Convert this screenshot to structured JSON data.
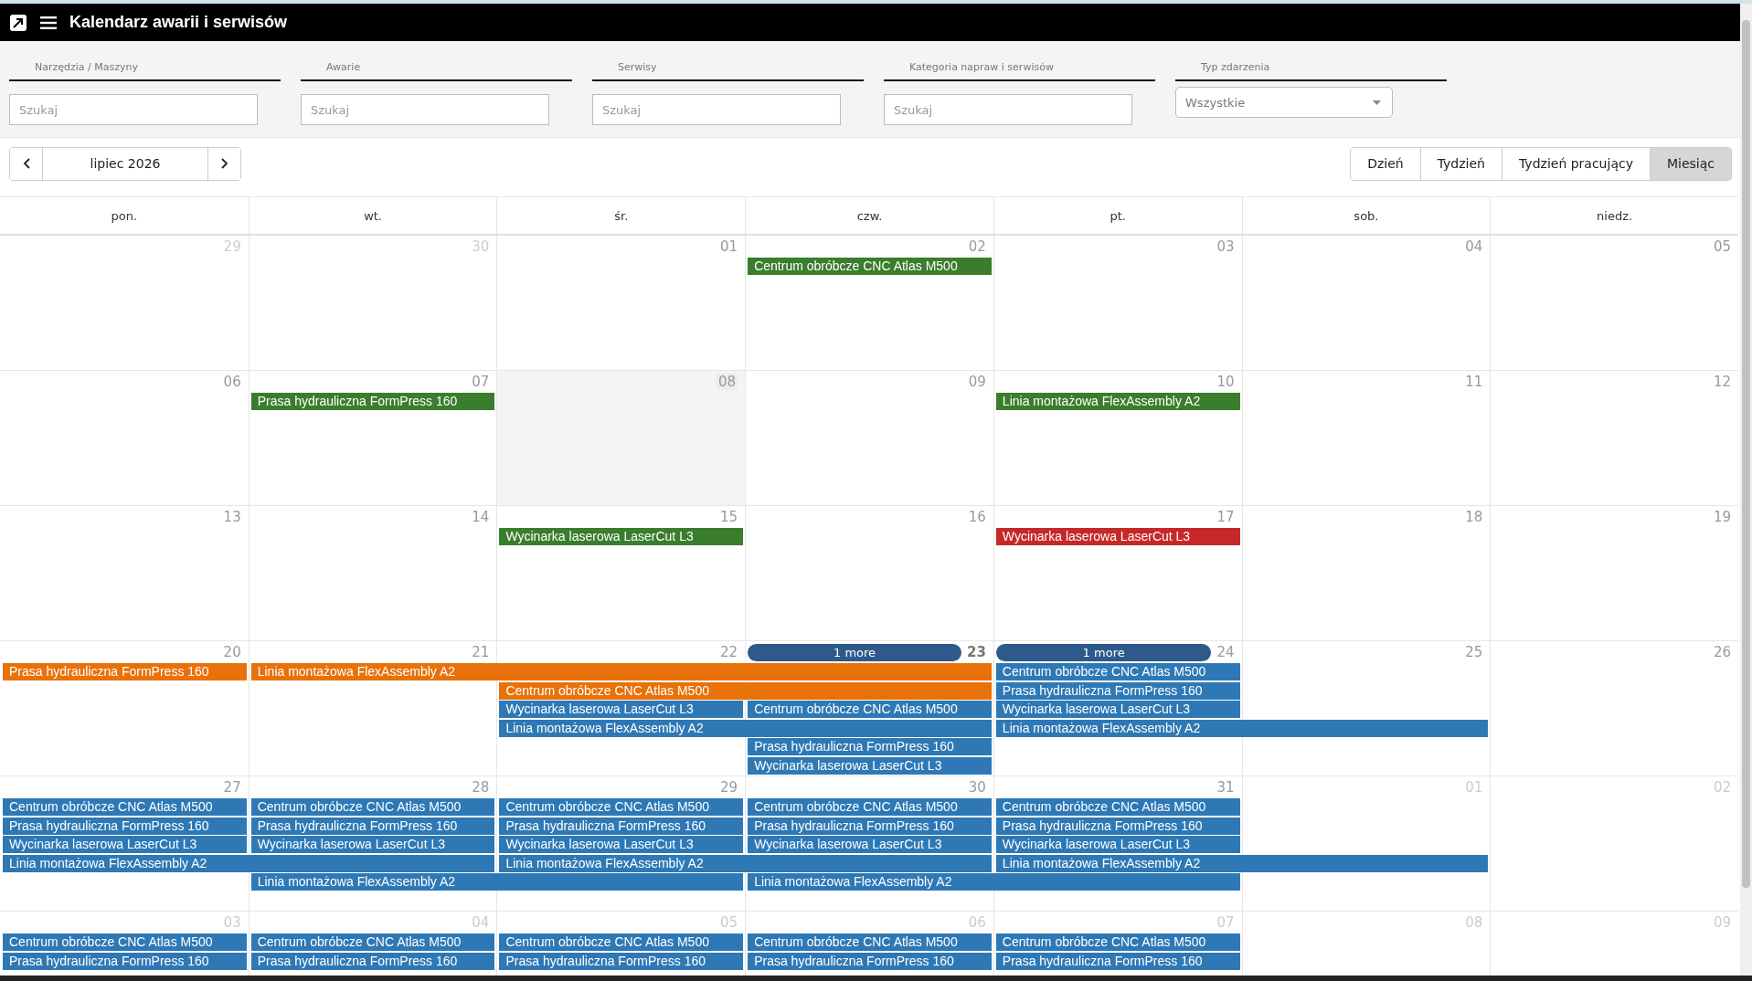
{
  "window": {
    "title": "Kalendarz awarii i serwisów"
  },
  "filters": [
    {
      "kind": "search",
      "label": "Narzędzia / Maszyny",
      "placeholder": "Szukaj"
    },
    {
      "kind": "search",
      "label": "Awarie",
      "placeholder": "Szukaj"
    },
    {
      "kind": "search",
      "label": "Serwisy",
      "placeholder": "Szukaj"
    },
    {
      "kind": "search",
      "label": "Kategoria napraw i serwisów",
      "placeholder": "Szukaj"
    },
    {
      "kind": "select",
      "label": "Typ zdarzenia",
      "value": "Wszystkie"
    }
  ],
  "navigation": {
    "period": "lipiec 2026"
  },
  "views": [
    {
      "label": "Dzień",
      "selected": false
    },
    {
      "label": "Tydzień",
      "selected": false
    },
    {
      "label": "Tydzień pracujący",
      "selected": false
    },
    {
      "label": "Miesiąc",
      "selected": true
    }
  ],
  "weekdays": [
    "pon.",
    "wt.",
    "śr.",
    "czw.",
    "pt.",
    "sob.",
    "niedz."
  ],
  "weeks": [
    {
      "days": [
        {
          "date": "29",
          "other_month": true,
          "selected": false,
          "today": false
        },
        {
          "date": "30",
          "other_month": true,
          "selected": false,
          "today": false
        },
        {
          "date": "01",
          "other_month": false,
          "selected": false,
          "today": false
        },
        {
          "date": "02",
          "other_month": false,
          "selected": false,
          "today": false
        },
        {
          "date": "03",
          "other_month": false,
          "selected": false,
          "today": false
        },
        {
          "date": "04",
          "other_month": false,
          "selected": false,
          "today": false
        },
        {
          "date": "05",
          "other_month": false,
          "selected": false,
          "today": false
        }
      ],
      "lanes": [
        [
          {
            "kind": "empty"
          },
          {
            "kind": "empty"
          },
          {
            "kind": "empty"
          },
          {
            "kind": "event",
            "title": "Centrum obróbcze CNC Atlas M500",
            "color": "#3a7d2c"
          },
          {
            "kind": "empty"
          },
          {
            "kind": "empty"
          },
          {
            "kind": "empty"
          }
        ]
      ]
    },
    {
      "days": [
        {
          "date": "06",
          "other_month": false,
          "selected": false,
          "today": false
        },
        {
          "date": "07",
          "other_month": false,
          "selected": false,
          "today": false
        },
        {
          "date": "08",
          "other_month": false,
          "selected": true,
          "today": false
        },
        {
          "date": "09",
          "other_month": false,
          "selected": false,
          "today": false
        },
        {
          "date": "10",
          "other_month": false,
          "selected": false,
          "today": false
        },
        {
          "date": "11",
          "other_month": false,
          "selected": false,
          "today": false
        },
        {
          "date": "12",
          "other_month": false,
          "selected": false,
          "today": false
        }
      ],
      "lanes": [
        [
          {
            "kind": "empty"
          },
          {
            "kind": "event",
            "title": "Prasa hydrauliczna FormPress 160",
            "color": "#3a7d2c"
          },
          {
            "kind": "empty"
          },
          {
            "kind": "empty"
          },
          {
            "kind": "event",
            "title": "Linia montażowa FlexAssembly A2",
            "color": "#3a7d2c"
          },
          {
            "kind": "empty"
          },
          {
            "kind": "empty"
          }
        ]
      ]
    },
    {
      "days": [
        {
          "date": "13",
          "other_month": false,
          "selected": false,
          "today": false
        },
        {
          "date": "14",
          "other_month": false,
          "selected": false,
          "today": false
        },
        {
          "date": "15",
          "other_month": false,
          "selected": false,
          "today": false
        },
        {
          "date": "16",
          "other_month": false,
          "selected": false,
          "today": false
        },
        {
          "date": "17",
          "other_month": false,
          "selected": false,
          "today": false
        },
        {
          "date": "18",
          "other_month": false,
          "selected": false,
          "today": false
        },
        {
          "date": "19",
          "other_month": false,
          "selected": false,
          "today": false
        }
      ],
      "lanes": [
        [
          {
            "kind": "empty"
          },
          {
            "kind": "empty"
          },
          {
            "kind": "event",
            "title": "Wycinarka laserowa LaserCut L3",
            "color": "#3a7d2c"
          },
          {
            "kind": "empty"
          },
          {
            "kind": "event",
            "title": "Wycinarka laserowa LaserCut L3",
            "color": "#c62828"
          },
          {
            "kind": "empty"
          },
          {
            "kind": "empty"
          }
        ]
      ]
    },
    {
      "days": [
        {
          "date": "20",
          "other_month": false,
          "selected": false,
          "today": false
        },
        {
          "date": "21",
          "other_month": false,
          "selected": false,
          "today": false
        },
        {
          "date": "22",
          "other_month": false,
          "selected": false,
          "today": false
        },
        {
          "date": "23",
          "other_month": false,
          "selected": false,
          "today": true,
          "more": "1 more"
        },
        {
          "date": "24",
          "other_month": false,
          "selected": false,
          "today": false,
          "more": "1 more"
        },
        {
          "date": "25",
          "other_month": false,
          "selected": false,
          "today": false
        },
        {
          "date": "26",
          "other_month": false,
          "selected": false,
          "today": false
        }
      ],
      "lanes": [
        [
          {
            "kind": "event",
            "title": "Prasa hydrauliczna FormPress 160",
            "color": "#e8710a"
          },
          {
            "kind": "event",
            "title": "Linia montażowa FlexAssembly A2",
            "color": "#e8710a"
          },
          {
            "kind": "continued"
          },
          {
            "kind": "continued"
          },
          {
            "kind": "event",
            "title": "Centrum obróbcze CNC Atlas M500",
            "color": "#2e79b5"
          },
          {
            "kind": "empty"
          },
          {
            "kind": "empty"
          }
        ],
        [
          {
            "kind": "empty"
          },
          {
            "kind": "empty"
          },
          {
            "kind": "event",
            "title": "Centrum obróbcze CNC Atlas M500",
            "color": "#e8710a"
          },
          {
            "kind": "continued"
          },
          {
            "kind": "event",
            "title": "Prasa hydrauliczna FormPress 160",
            "color": "#2e79b5"
          },
          {
            "kind": "empty"
          },
          {
            "kind": "empty"
          }
        ],
        [
          {
            "kind": "empty"
          },
          {
            "kind": "empty"
          },
          {
            "kind": "event",
            "title": "Wycinarka laserowa LaserCut L3",
            "color": "#2e79b5"
          },
          {
            "kind": "event",
            "title": "Centrum obróbcze CNC Atlas M500",
            "color": "#2e79b5"
          },
          {
            "kind": "event",
            "title": "Wycinarka laserowa LaserCut L3",
            "color": "#2e79b5"
          },
          {
            "kind": "empty"
          },
          {
            "kind": "empty"
          }
        ],
        [
          {
            "kind": "empty"
          },
          {
            "kind": "empty"
          },
          {
            "kind": "event",
            "title": "Linia montażowa FlexAssembly A2",
            "color": "#2e79b5"
          },
          {
            "kind": "continued"
          },
          {
            "kind": "event",
            "title": "Linia montażowa FlexAssembly A2",
            "color": "#2e79b5"
          },
          {
            "kind": "continued"
          },
          {
            "kind": "empty"
          }
        ],
        [
          {
            "kind": "empty"
          },
          {
            "kind": "empty"
          },
          {
            "kind": "empty"
          },
          {
            "kind": "event",
            "title": "Prasa hydrauliczna FormPress 160",
            "color": "#2e79b5"
          },
          {
            "kind": "empty"
          },
          {
            "kind": "empty"
          },
          {
            "kind": "empty"
          }
        ],
        [
          {
            "kind": "empty"
          },
          {
            "kind": "empty"
          },
          {
            "kind": "empty"
          },
          {
            "kind": "event",
            "title": "Wycinarka laserowa LaserCut L3",
            "color": "#2e79b5"
          },
          {
            "kind": "empty"
          },
          {
            "kind": "empty"
          },
          {
            "kind": "empty"
          }
        ]
      ]
    },
    {
      "days": [
        {
          "date": "27",
          "other_month": false,
          "selected": false,
          "today": false
        },
        {
          "date": "28",
          "other_month": false,
          "selected": false,
          "today": false
        },
        {
          "date": "29",
          "other_month": false,
          "selected": false,
          "today": false
        },
        {
          "date": "30",
          "other_month": false,
          "selected": false,
          "today": false
        },
        {
          "date": "31",
          "other_month": false,
          "selected": false,
          "today": false
        },
        {
          "date": "01",
          "other_month": true,
          "selected": false,
          "today": false
        },
        {
          "date": "02",
          "other_month": true,
          "selected": false,
          "today": false
        }
      ],
      "lanes": [
        [
          {
            "kind": "event",
            "title": "Centrum obróbcze CNC Atlas M500",
            "color": "#2e79b5"
          },
          {
            "kind": "event",
            "title": "Centrum obróbcze CNC Atlas M500",
            "color": "#2e79b5"
          },
          {
            "kind": "event",
            "title": "Centrum obróbcze CNC Atlas M500",
            "color": "#2e79b5"
          },
          {
            "kind": "event",
            "title": "Centrum obróbcze CNC Atlas M500",
            "color": "#2e79b5"
          },
          {
            "kind": "event",
            "title": "Centrum obróbcze CNC Atlas M500",
            "color": "#2e79b5"
          },
          {
            "kind": "empty"
          },
          {
            "kind": "empty"
          }
        ],
        [
          {
            "kind": "event",
            "title": "Prasa hydrauliczna FormPress 160",
            "color": "#2e79b5"
          },
          {
            "kind": "event",
            "title": "Prasa hydrauliczna FormPress 160",
            "color": "#2e79b5"
          },
          {
            "kind": "event",
            "title": "Prasa hydrauliczna FormPress 160",
            "color": "#2e79b5"
          },
          {
            "kind": "event",
            "title": "Prasa hydrauliczna FormPress 160",
            "color": "#2e79b5"
          },
          {
            "kind": "event",
            "title": "Prasa hydrauliczna FormPress 160",
            "color": "#2e79b5"
          },
          {
            "kind": "empty"
          },
          {
            "kind": "empty"
          }
        ],
        [
          {
            "kind": "event",
            "title": "Wycinarka laserowa LaserCut L3",
            "color": "#2e79b5"
          },
          {
            "kind": "event",
            "title": "Wycinarka laserowa LaserCut L3",
            "color": "#2e79b5"
          },
          {
            "kind": "event",
            "title": "Wycinarka laserowa LaserCut L3",
            "color": "#2e79b5"
          },
          {
            "kind": "event",
            "title": "Wycinarka laserowa LaserCut L3",
            "color": "#2e79b5"
          },
          {
            "kind": "event",
            "title": "Wycinarka laserowa LaserCut L3",
            "color": "#2e79b5"
          },
          {
            "kind": "empty"
          },
          {
            "kind": "empty"
          }
        ],
        [
          {
            "kind": "event",
            "title": "Linia montażowa FlexAssembly A2",
            "color": "#2e79b5"
          },
          {
            "kind": "continued"
          },
          {
            "kind": "event",
            "title": "Linia montażowa FlexAssembly A2",
            "color": "#2e79b5"
          },
          {
            "kind": "continued"
          },
          {
            "kind": "event",
            "title": "Linia montażowa FlexAssembly A2",
            "color": "#2e79b5"
          },
          {
            "kind": "continued"
          },
          {
            "kind": "empty"
          }
        ],
        [
          {
            "kind": "empty"
          },
          {
            "kind": "event",
            "title": "Linia montażowa FlexAssembly A2",
            "color": "#2e79b5"
          },
          {
            "kind": "continued"
          },
          {
            "kind": "event",
            "title": "Linia montażowa FlexAssembly A2",
            "color": "#2e79b5"
          },
          {
            "kind": "continued"
          },
          {
            "kind": "empty"
          },
          {
            "kind": "empty"
          }
        ]
      ]
    },
    {
      "days": [
        {
          "date": "03",
          "other_month": true,
          "selected": false,
          "today": false
        },
        {
          "date": "04",
          "other_month": true,
          "selected": false,
          "today": false
        },
        {
          "date": "05",
          "other_month": true,
          "selected": false,
          "today": false
        },
        {
          "date": "06",
          "other_month": true,
          "selected": false,
          "today": false
        },
        {
          "date": "07",
          "other_month": true,
          "selected": false,
          "today": false
        },
        {
          "date": "08",
          "other_month": true,
          "selected": false,
          "today": false
        },
        {
          "date": "09",
          "other_month": true,
          "selected": false,
          "today": false
        }
      ],
      "lanes": [
        [
          {
            "kind": "event",
            "title": "Centrum obróbcze CNC Atlas M500",
            "color": "#2e79b5"
          },
          {
            "kind": "event",
            "title": "Centrum obróbcze CNC Atlas M500",
            "color": "#2e79b5"
          },
          {
            "kind": "event",
            "title": "Centrum obróbcze CNC Atlas M500",
            "color": "#2e79b5"
          },
          {
            "kind": "event",
            "title": "Centrum obróbcze CNC Atlas M500",
            "color": "#2e79b5"
          },
          {
            "kind": "event",
            "title": "Centrum obróbcze CNC Atlas M500",
            "color": "#2e79b5"
          },
          {
            "kind": "empty"
          },
          {
            "kind": "empty"
          }
        ],
        [
          {
            "kind": "event",
            "title": "Prasa hydrauliczna FormPress 160",
            "color": "#2e79b5"
          },
          {
            "kind": "event",
            "title": "Prasa hydrauliczna FormPress 160",
            "color": "#2e79b5"
          },
          {
            "kind": "event",
            "title": "Prasa hydrauliczna FormPress 160",
            "color": "#2e79b5"
          },
          {
            "kind": "event",
            "title": "Prasa hydrauliczna FormPress 160",
            "color": "#2e79b5"
          },
          {
            "kind": "event",
            "title": "Prasa hydrauliczna FormPress 160",
            "color": "#2e79b5"
          },
          {
            "kind": "empty"
          },
          {
            "kind": "empty"
          }
        ]
      ]
    }
  ]
}
